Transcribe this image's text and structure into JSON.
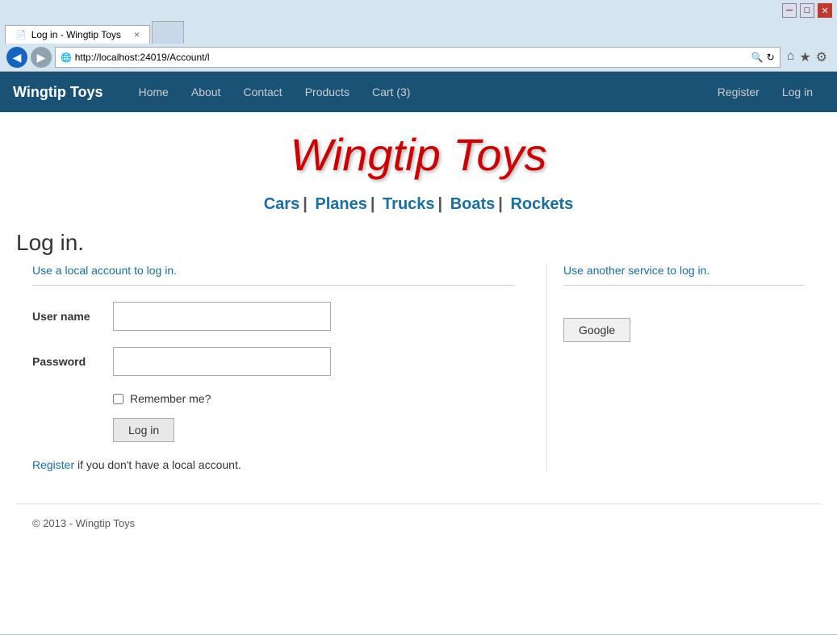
{
  "browser": {
    "url": "http://localhost:24019/Account/l",
    "tab_title": "Log in - Wingtip Toys",
    "tab_close": "×",
    "btn_back": "◀",
    "btn_fwd": "▶",
    "btn_reload": "↻",
    "btn_search": "🔍",
    "icon_home": "⌂",
    "icon_star": "★",
    "icon_gear": "⚙"
  },
  "navbar": {
    "brand": "Wingtip Toys",
    "links": [
      {
        "label": "Home",
        "name": "home"
      },
      {
        "label": "About",
        "name": "about"
      },
      {
        "label": "Contact",
        "name": "contact"
      },
      {
        "label": "Products",
        "name": "products"
      },
      {
        "label": "Cart (3)",
        "name": "cart"
      }
    ],
    "right_links": [
      {
        "label": "Register",
        "name": "register"
      },
      {
        "label": "Log in",
        "name": "login"
      }
    ]
  },
  "page": {
    "site_title": "Wingtip Toys",
    "categories": [
      {
        "label": "Cars",
        "name": "cars"
      },
      {
        "label": "Planes",
        "name": "planes"
      },
      {
        "label": "Trucks",
        "name": "trucks"
      },
      {
        "label": "Boats",
        "name": "boats"
      },
      {
        "label": "Rockets",
        "name": "rockets"
      }
    ],
    "heading": "Log in.",
    "local_account_label": "Use a local account to log in.",
    "other_service_label": "Use another service to log in.",
    "username_label": "User name",
    "password_label": "Password",
    "remember_label": "Remember me?",
    "login_btn": "Log in",
    "google_btn": "Google",
    "register_text": " if you don't have a local account.",
    "register_link_text": "Register"
  },
  "footer": {
    "text": "© 2013 - Wingtip Toys"
  }
}
